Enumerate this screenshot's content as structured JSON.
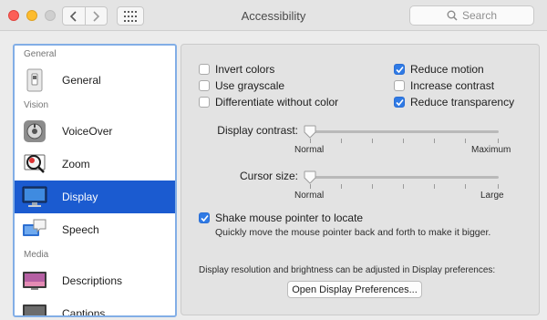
{
  "window": {
    "title": "Accessibility"
  },
  "search": {
    "placeholder": "Search"
  },
  "sidebar": {
    "sections": [
      "General",
      "Vision",
      "Media"
    ],
    "items": [
      {
        "label": "General",
        "icon": "switch-icon"
      },
      {
        "label": "VoiceOver",
        "icon": "voiceover-icon"
      },
      {
        "label": "Zoom",
        "icon": "zoom-icon"
      },
      {
        "label": "Display",
        "icon": "display-icon",
        "selected": true
      },
      {
        "label": "Speech",
        "icon": "speech-icon"
      },
      {
        "label": "Descriptions",
        "icon": "descriptions-icon"
      },
      {
        "label": "Captions",
        "icon": "captions-icon"
      }
    ]
  },
  "options": {
    "invert_colors": {
      "label": "Invert colors",
      "checked": false
    },
    "use_grayscale": {
      "label": "Use grayscale",
      "checked": false
    },
    "differentiate": {
      "label": "Differentiate without color",
      "checked": false
    },
    "reduce_motion": {
      "label": "Reduce motion",
      "checked": true
    },
    "increase_contrast": {
      "label": "Increase contrast",
      "checked": false
    },
    "reduce_transparency": {
      "label": "Reduce transparency",
      "checked": true
    }
  },
  "display_contrast": {
    "label": "Display contrast:",
    "min_label": "Normal",
    "max_label": "Maximum",
    "value": 0
  },
  "cursor_size": {
    "label": "Cursor size:",
    "min_label": "Normal",
    "max_label": "Large",
    "value": 0
  },
  "shake": {
    "label": "Shake mouse pointer to locate",
    "checked": true,
    "description": "Quickly move the mouse pointer back and forth to make it bigger."
  },
  "footer": {
    "note": "Display resolution and brightness can be adjusted in Display preferences:",
    "button_label": "Open Display Preferences..."
  },
  "colors": {
    "accent": "#2f7ae5",
    "selection": "#1b5bd0"
  }
}
